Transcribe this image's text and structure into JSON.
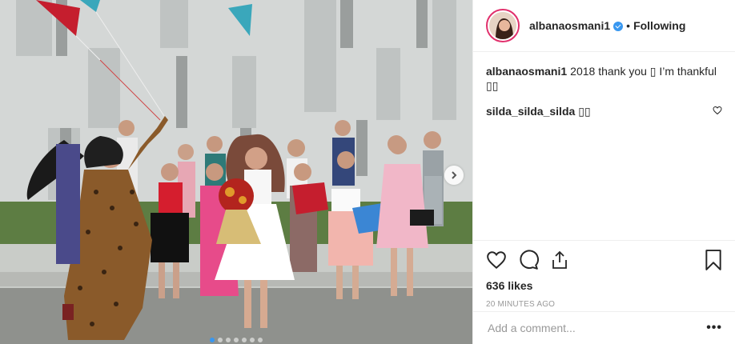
{
  "post": {
    "author": "albanaosmani1",
    "follow_status": "Following",
    "bullet": "•",
    "likes": "636 likes",
    "time": "20 MINUTES AGO",
    "add_comment_placeholder": "Add a comment...",
    "more_label": "•••"
  },
  "comments": [
    {
      "user": "albanaosmani1",
      "text": "2018 thank you ▯ I’m thankful ▯▯"
    },
    {
      "user": "silda_silda_silda",
      "text": "▯▯"
    }
  ],
  "carousel": {
    "count": 7,
    "active": 0
  },
  "colors": {
    "accent": "#3897f0",
    "text": "#262626",
    "muted": "#999999"
  },
  "icons": [
    "heart-icon",
    "comment-icon",
    "share-icon",
    "bookmark-icon",
    "verified-badge-icon",
    "next-arrow-icon"
  ]
}
